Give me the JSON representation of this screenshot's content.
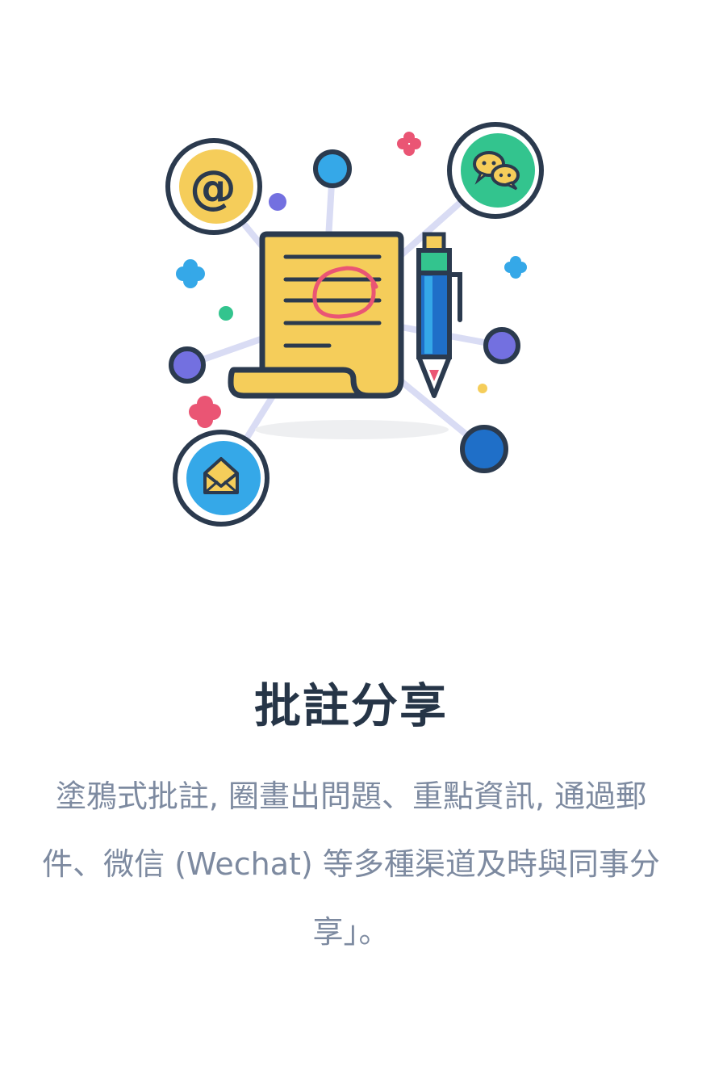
{
  "feature": {
    "title": "批註分享",
    "description": "塗鴉式批註, 圈畫出問題、重點資訊, 通過郵件、微信 (Wechat) 等多種渠道及時與同事分享」。"
  },
  "illustration": {
    "icons": [
      "at-icon",
      "wechat-icon",
      "envelope-icon",
      "document-icon",
      "pen-icon"
    ],
    "colors": {
      "outline": "#2b3a4e",
      "yellow": "#f5cd5a",
      "green": "#33c48e",
      "blue": "#35a8e8",
      "dark_blue": "#1f6fc8",
      "purple": "#7370e0",
      "pink": "#ea5574",
      "link": "#d9dcf4",
      "shadow": "#eeeff1"
    }
  }
}
